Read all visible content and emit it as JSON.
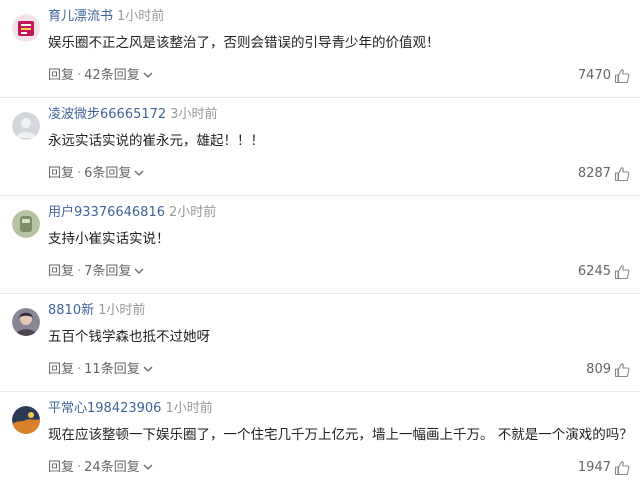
{
  "comments": [
    {
      "username": "育儿漂流书",
      "time": "1小时前",
      "content": "娱乐圈不正之风是该整治了，否则会错误的引导青少年的价值观！",
      "reply_label": "回复",
      "separator": "·",
      "replies_label": "42条回复",
      "likes": "7470",
      "avatar_color": "#c2185b"
    },
    {
      "username": "凌波微步66665172",
      "time": "3小时前",
      "content": "永远实话实说的崔永元，雄起！！！",
      "reply_label": "回复",
      "separator": "·",
      "replies_label": "6条回复",
      "likes": "8287",
      "avatar_color": "#c8ccd2"
    },
    {
      "username": "用户93376646816",
      "time": "2小时前",
      "content": "支持小崔实话实说！",
      "reply_label": "回复",
      "separator": "·",
      "replies_label": "7条回复",
      "likes": "6245",
      "avatar_color": "#8fa37a"
    },
    {
      "username": "8810新",
      "time": "1小时前",
      "content": "五百个钱学森也抵不过她呀",
      "reply_label": "回复",
      "separator": "·",
      "replies_label": "11条回复",
      "likes": "809",
      "avatar_color": "#5a5565"
    },
    {
      "username": "平常心198423906",
      "time": "1小时前",
      "content": "现在应该整顿一下娱乐圈了，一个住宅几千万上亿元，墙上一幅画上千万。 不就是一个演戏的吗？",
      "reply_label": "回复",
      "separator": "·",
      "replies_label": "24条回复",
      "likes": "1947",
      "avatar_color": "#2b3a55"
    }
  ],
  "colors": {
    "username": "#406599",
    "meta_gray": "#999999",
    "action_gray": "#666666",
    "divider": "#e8e8e8"
  },
  "icons": {
    "like": "thumbs-up-icon",
    "expand": "chevron-down-icon"
  }
}
